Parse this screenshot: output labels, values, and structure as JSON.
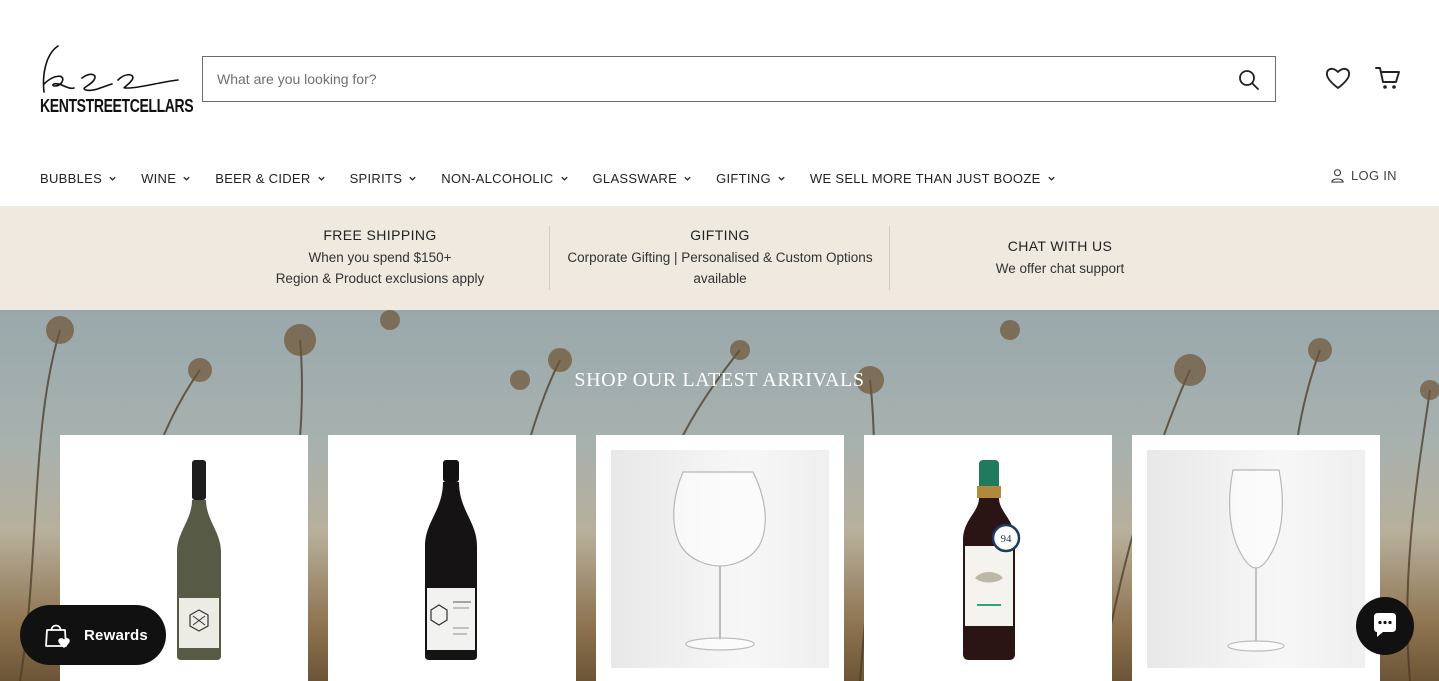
{
  "header": {
    "logo_text": "KENTSTREETCELLARS",
    "search_placeholder": "What are you looking for?"
  },
  "nav": {
    "items": [
      {
        "label": "BUBBLES"
      },
      {
        "label": "WINE"
      },
      {
        "label": "BEER & CIDER"
      },
      {
        "label": "SPIRITS"
      },
      {
        "label": "NON-ALCOHOLIC"
      },
      {
        "label": "GLASSWARE"
      },
      {
        "label": "GIFTING"
      },
      {
        "label": "WE SELL MORE THAN JUST BOOZE"
      }
    ],
    "login_label": "LOG IN"
  },
  "infobar": {
    "shipping": {
      "title": "FREE SHIPPING",
      "line1": "When you spend $150+",
      "line2": "Region & Product exclusions apply"
    },
    "gifting": {
      "title": "GIFTING",
      "line1": "Corporate Gifting | Personalised & Custom Options",
      "line2": "available"
    },
    "chat": {
      "title": "CHAT WITH US",
      "line1": "We offer chat support"
    }
  },
  "hero": {
    "title": "SHOP OUR LATEST ARRIVALS",
    "products": [
      {
        "kind": "white-wine-bottle-icon"
      },
      {
        "kind": "red-wine-bottle-icon"
      },
      {
        "kind": "burgundy-glass-icon"
      },
      {
        "kind": "red-wine-bottle-green-cap-icon",
        "badge": "94"
      },
      {
        "kind": "flute-glass-icon"
      }
    ]
  },
  "widgets": {
    "rewards_label": "Rewards"
  },
  "colors": {
    "infobar_bg": "#efe9df",
    "text": "#1a1a1a",
    "rewards_bg": "#111111"
  }
}
